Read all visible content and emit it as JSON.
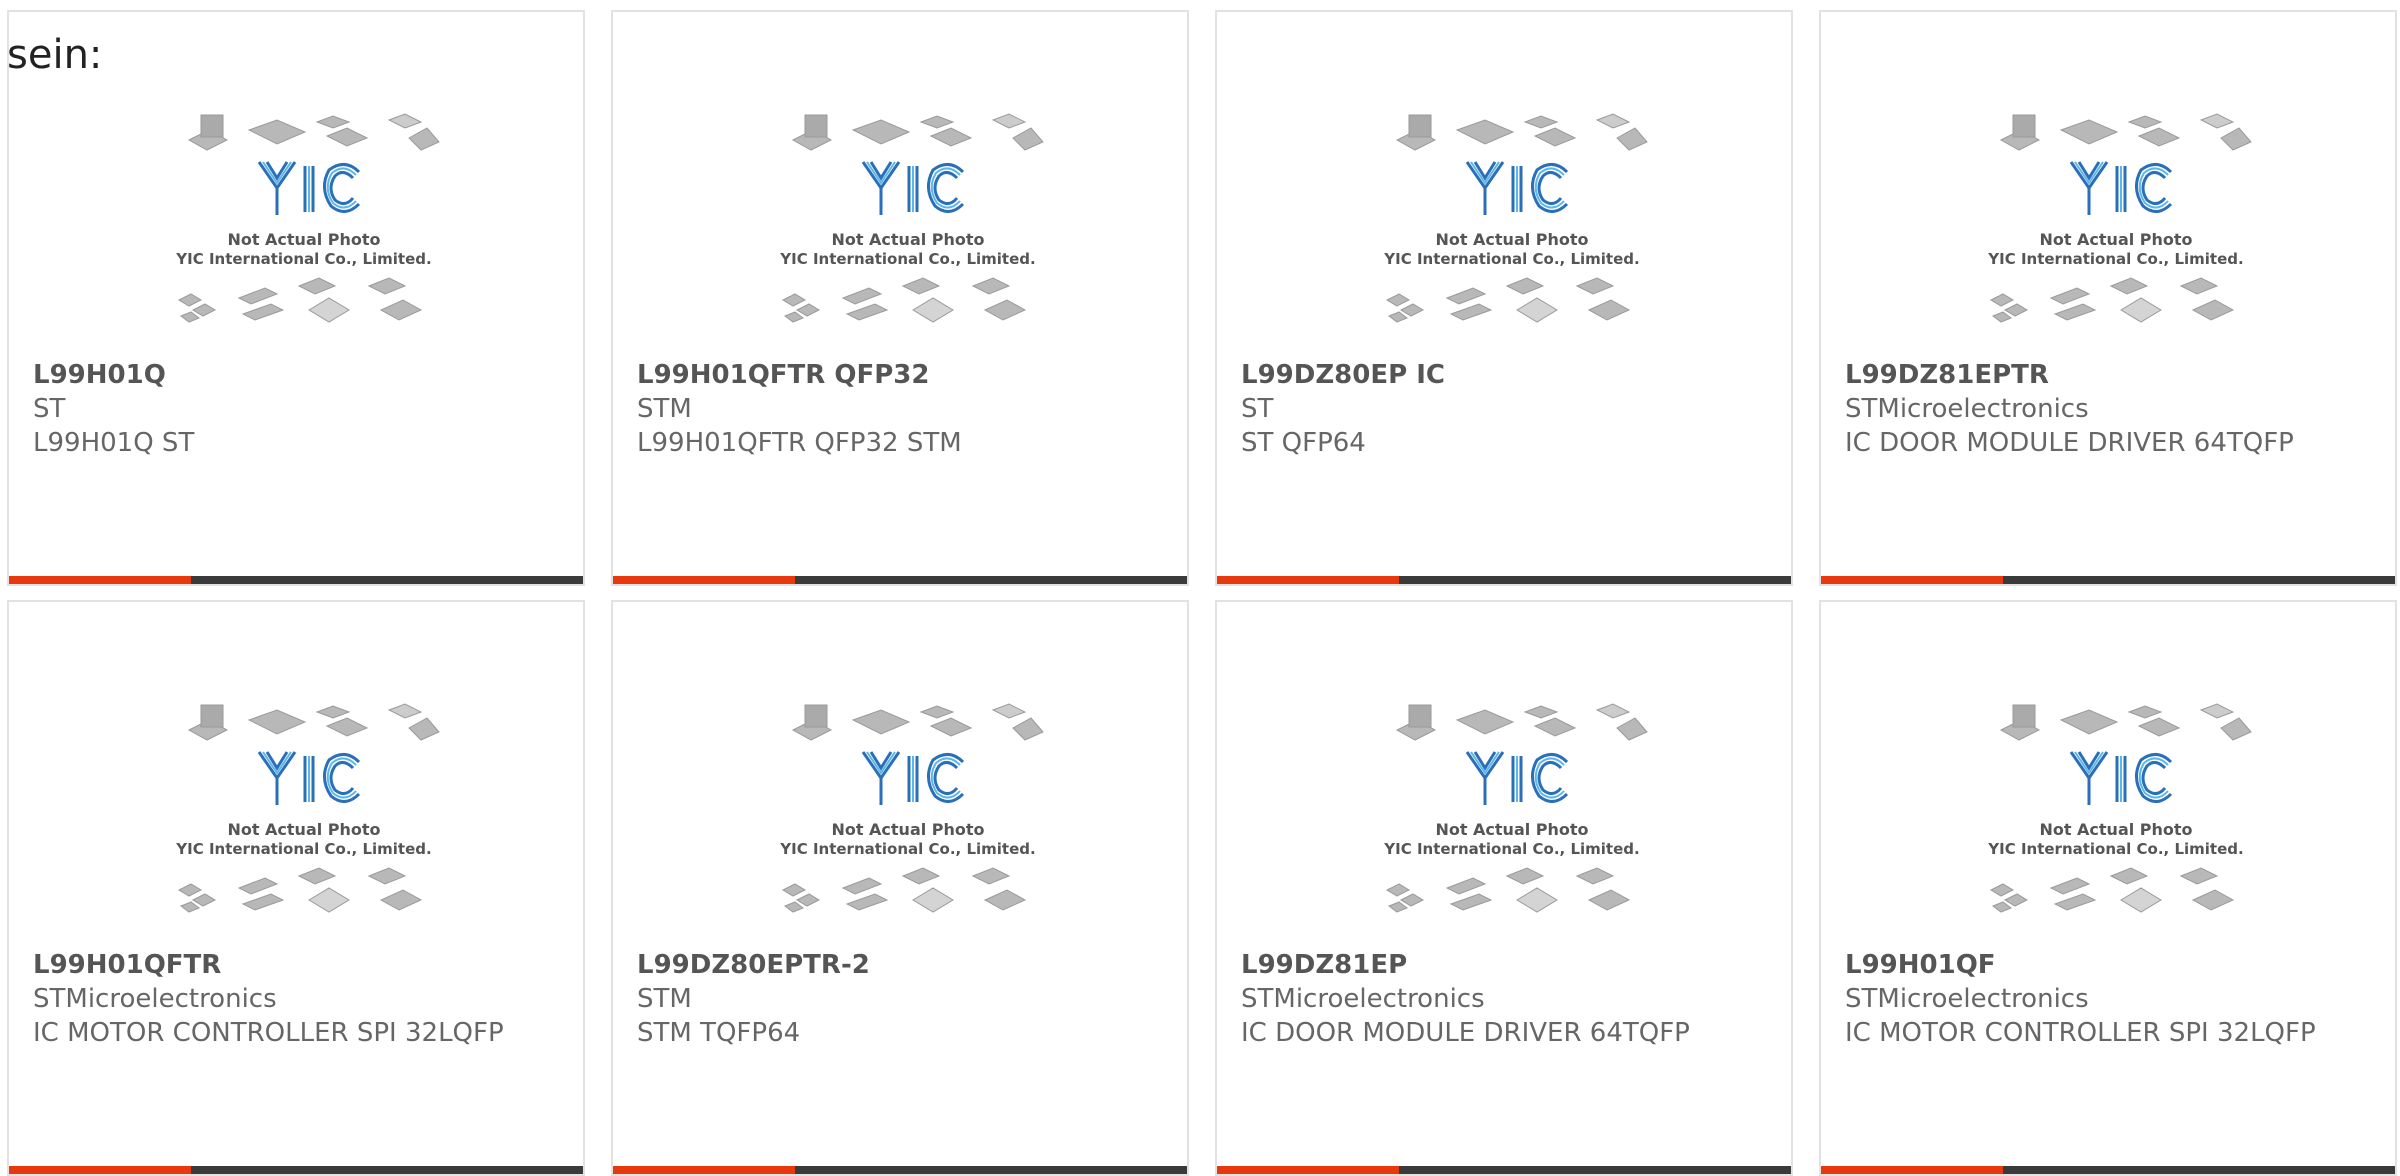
{
  "lead_text": "sein:",
  "colors": {
    "accent": "#e8390e",
    "bar": "#3a3a3a",
    "logo": "#2a8fd0",
    "chip": "#b4b4b4",
    "text": "#666666"
  },
  "placeholder": {
    "line1": "Not Actual Photo",
    "line2": "YIC International Co., Limited."
  },
  "products": [
    {
      "part": "L99H01Q",
      "maker": "ST",
      "desc": "L99H01Q ST"
    },
    {
      "part": "L99H01QFTR QFP32",
      "maker": "STM",
      "desc": "L99H01QFTR QFP32 STM"
    },
    {
      "part": "L99DZ80EP IC",
      "maker": "ST",
      "desc": "ST QFP64"
    },
    {
      "part": "L99DZ81EPTR",
      "maker": "STMicroelectronics",
      "desc": "IC DOOR MODULE DRIVER 64TQFP"
    },
    {
      "part": "L99H01QFTR",
      "maker": "STMicroelectronics",
      "desc": "IC MOTOR CONTROLLER SPI 32LQFP"
    },
    {
      "part": "L99DZ80EPTR-2",
      "maker": "STM",
      "desc": "STM TQFP64"
    },
    {
      "part": "L99DZ81EP",
      "maker": "STMicroelectronics",
      "desc": "IC DOOR MODULE DRIVER 64TQFP"
    },
    {
      "part": "L99H01QF",
      "maker": "STMicroelectronics",
      "desc": "IC MOTOR CONTROLLER SPI 32LQFP"
    }
  ]
}
